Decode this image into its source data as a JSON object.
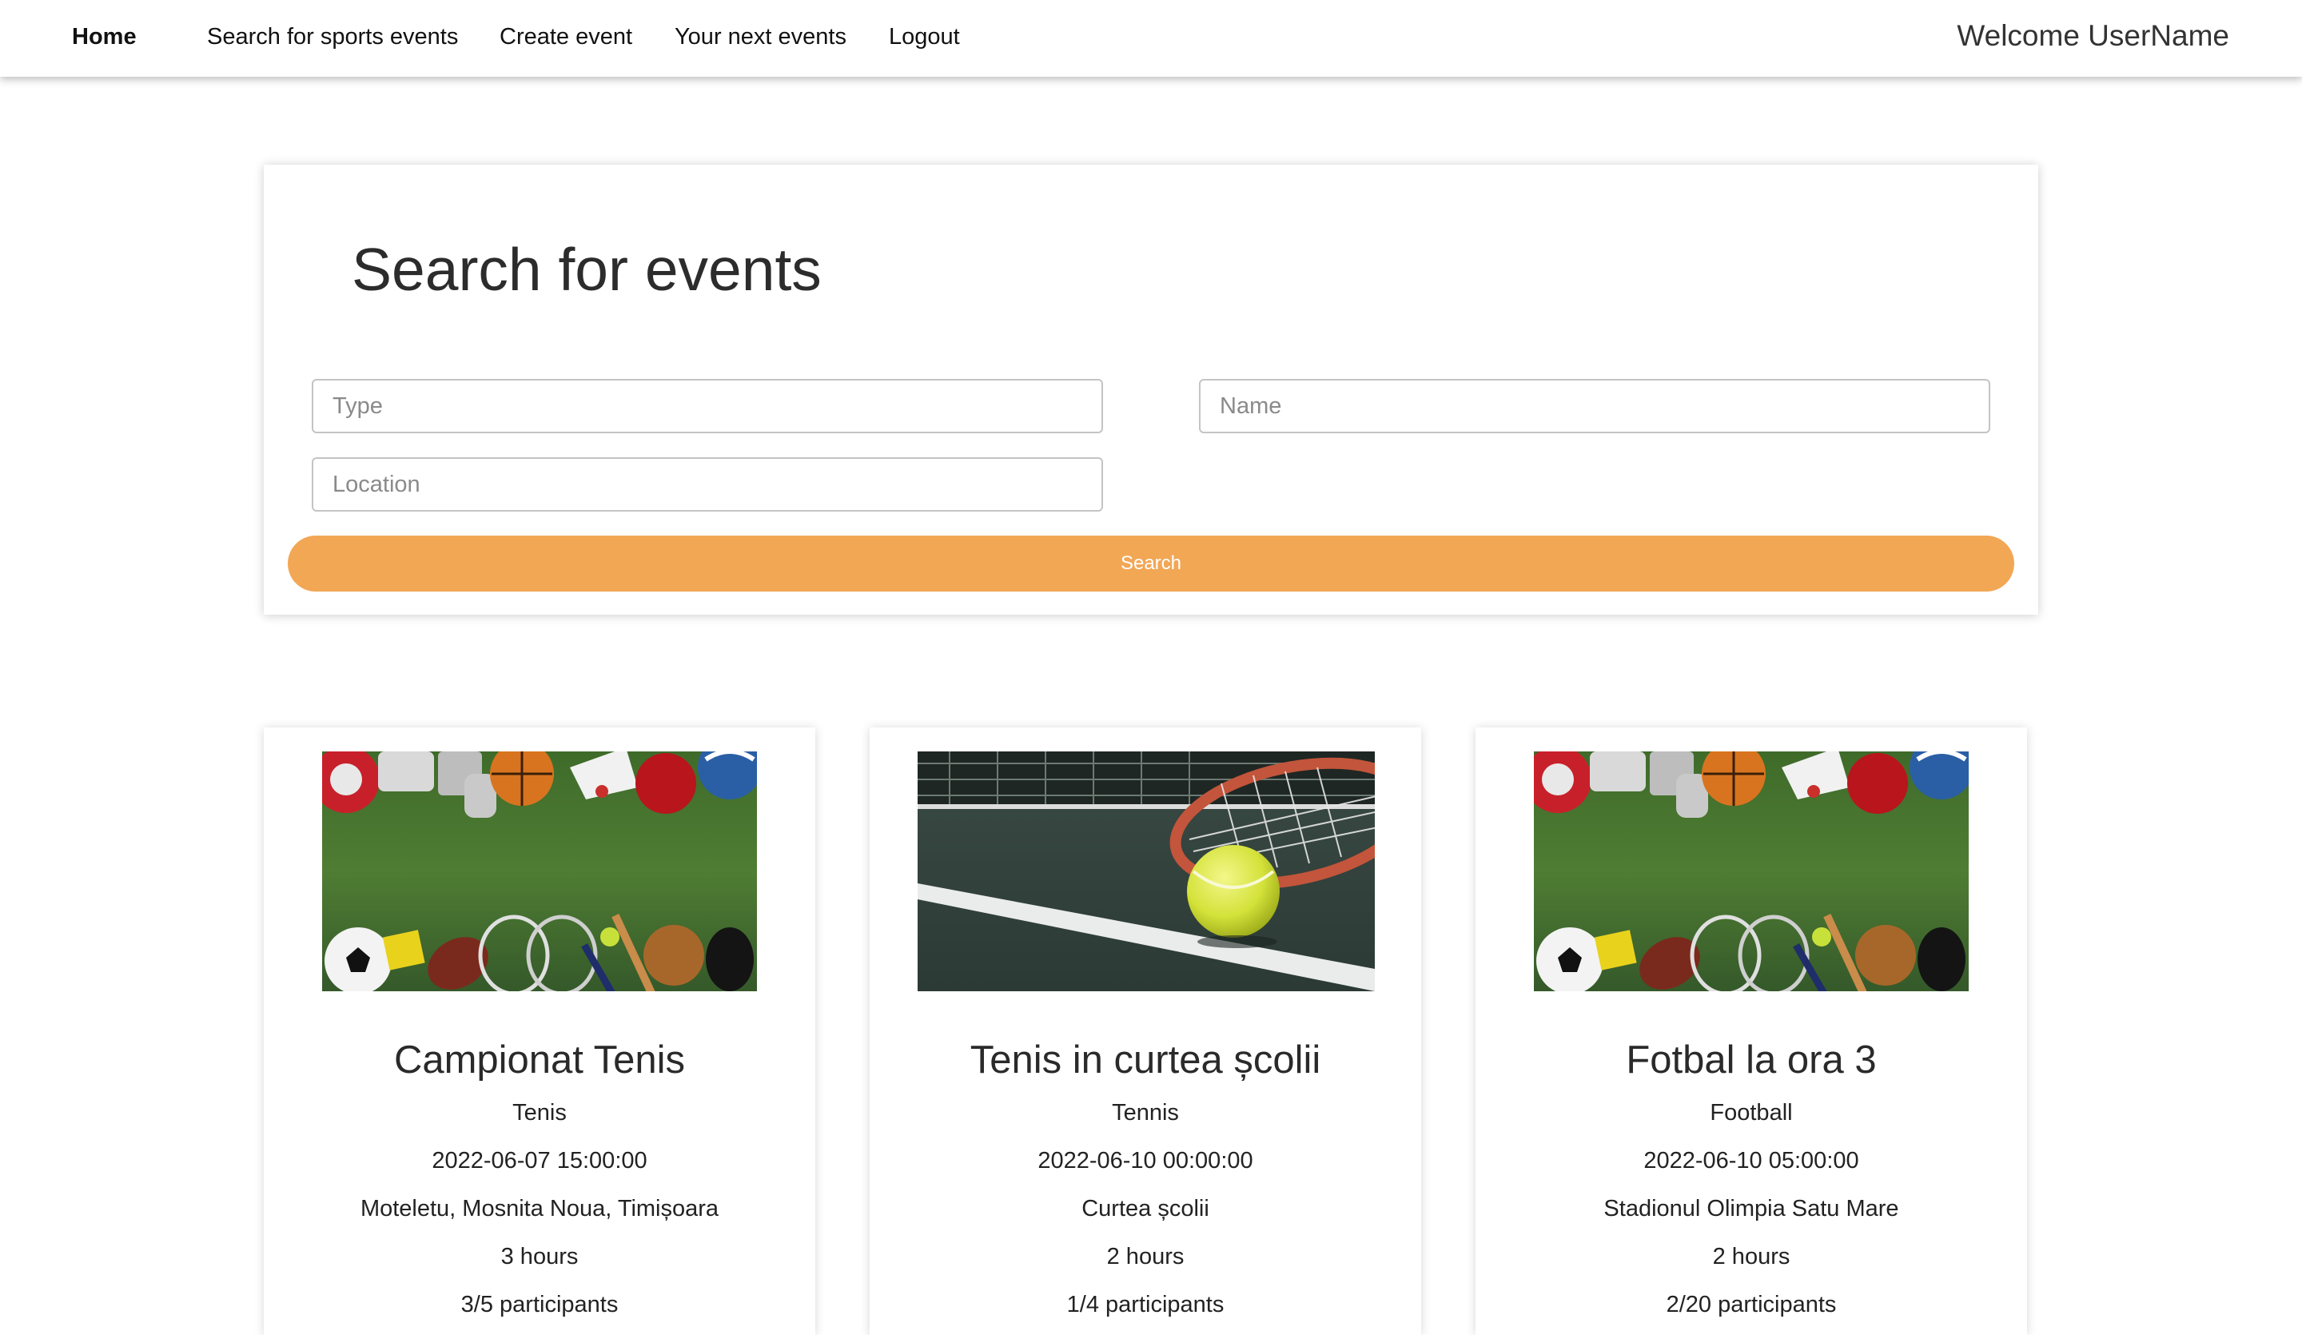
{
  "nav": {
    "home": "Home",
    "search_events": "Search for sports events",
    "create_event": "Create event",
    "next_events": "Your next events",
    "logout": "Logout",
    "welcome": "Welcome UserName"
  },
  "search": {
    "title": "Search for events",
    "type_placeholder": "Type",
    "name_placeholder": "Name",
    "location_placeholder": "Location",
    "button_label": "Search",
    "accent_color": "#f2a755"
  },
  "events": [
    {
      "title": "Campionat Tenis",
      "type": "Tenis",
      "date": "2022-06-07 15:00:00",
      "location": "Moteletu, Mosnita Noua, Timișoara",
      "duration": "3 hours",
      "participants": "3/5 participants",
      "image": "sports-equipment-on-grass"
    },
    {
      "title": "Tenis in curtea școlii",
      "type": "Tennis",
      "date": "2022-06-10 00:00:00",
      "location": "Curtea școlii",
      "duration": "2 hours",
      "participants": "1/4 participants",
      "image": "tennis-ball-and-racket-on-court"
    },
    {
      "title": "Fotbal la ora 3",
      "type": "Football",
      "date": "2022-06-10 05:00:00",
      "location": "Stadionul Olimpia Satu Mare",
      "duration": "2 hours",
      "participants": "2/20 participants",
      "image": "sports-equipment-on-grass"
    }
  ]
}
